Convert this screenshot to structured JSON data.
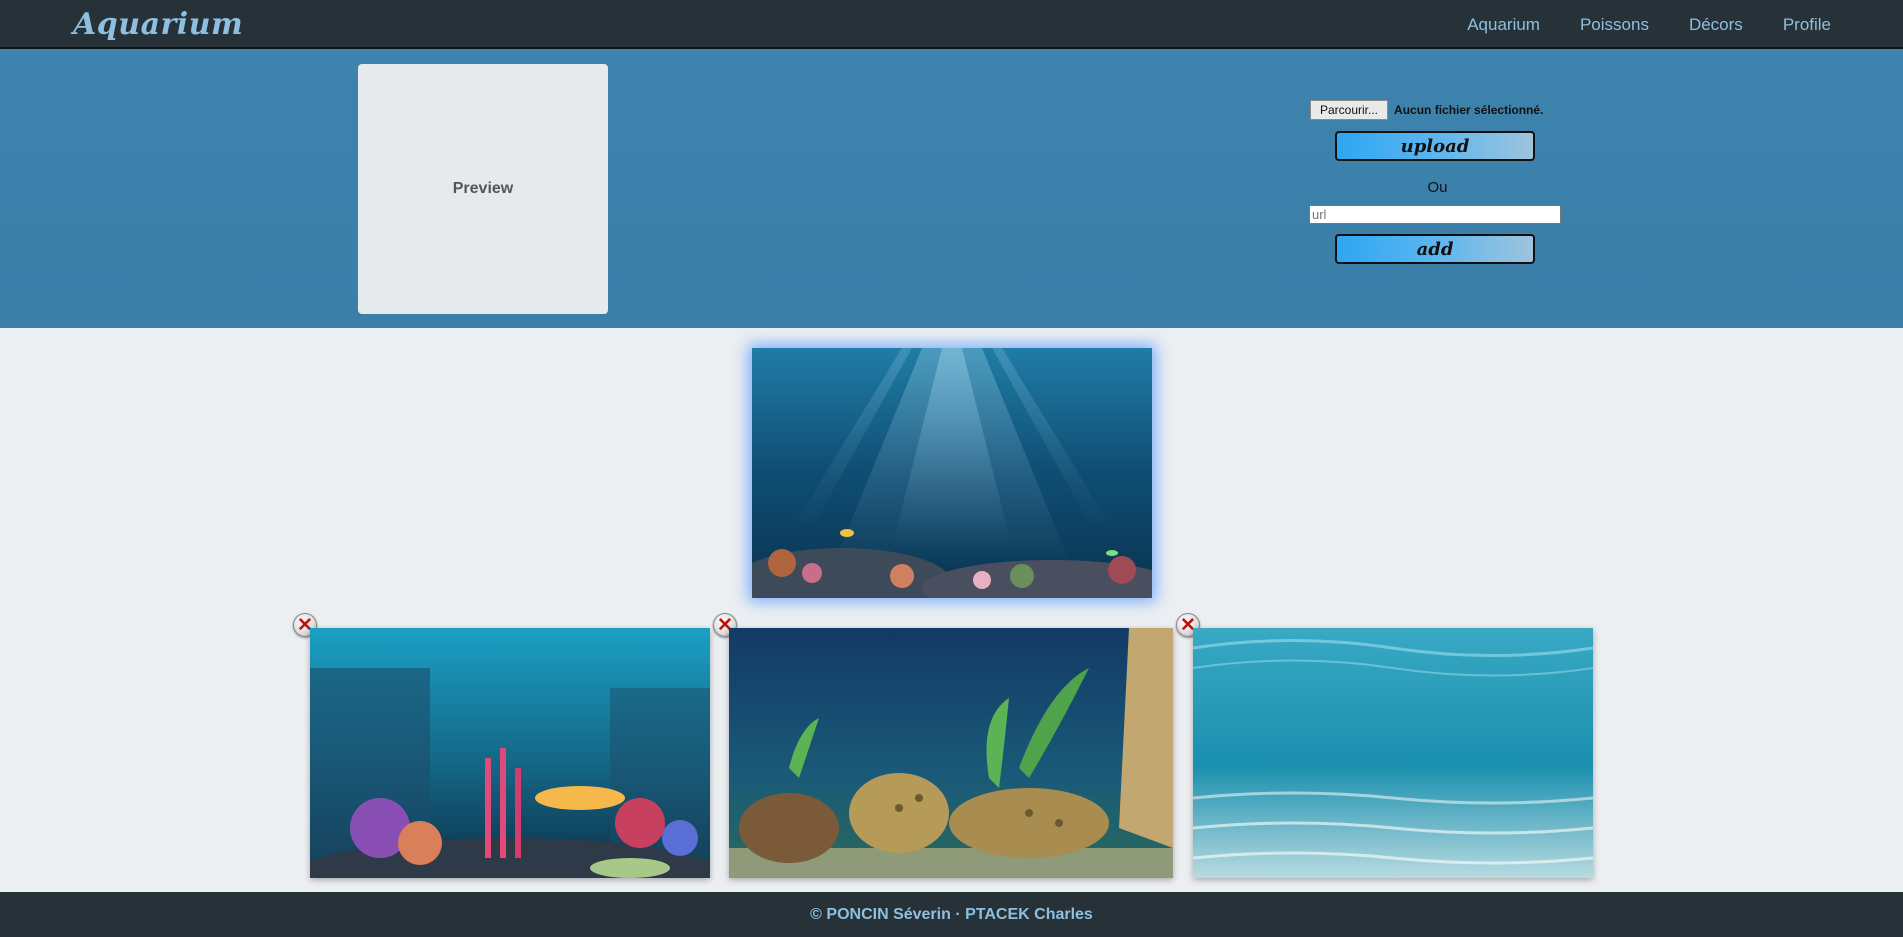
{
  "navbar": {
    "brand": "Aquarium",
    "links": [
      "Aquarium",
      "Poissons",
      "Décors",
      "Profile"
    ]
  },
  "upload": {
    "preview_label": "Preview",
    "file_button_label": "Parcourir...",
    "file_status": "Aucun fichier sélectionné.",
    "upload_button_label": "upload",
    "or_label": "Ou",
    "url_placeholder": "url",
    "add_button_label": "add"
  },
  "gallery": {
    "selected": "background-image-main",
    "items": [
      "background-image-1",
      "background-image-2",
      "background-image-3"
    ],
    "delete_icon": "close-icon"
  },
  "footer": {
    "text": "© PONCIN Séverin · PTACEK Charles"
  },
  "colors": {
    "navbar": "#263238",
    "nav_text": "#8fbfe0",
    "band": "#3b7fa9",
    "page_bg": "#eceff2"
  }
}
